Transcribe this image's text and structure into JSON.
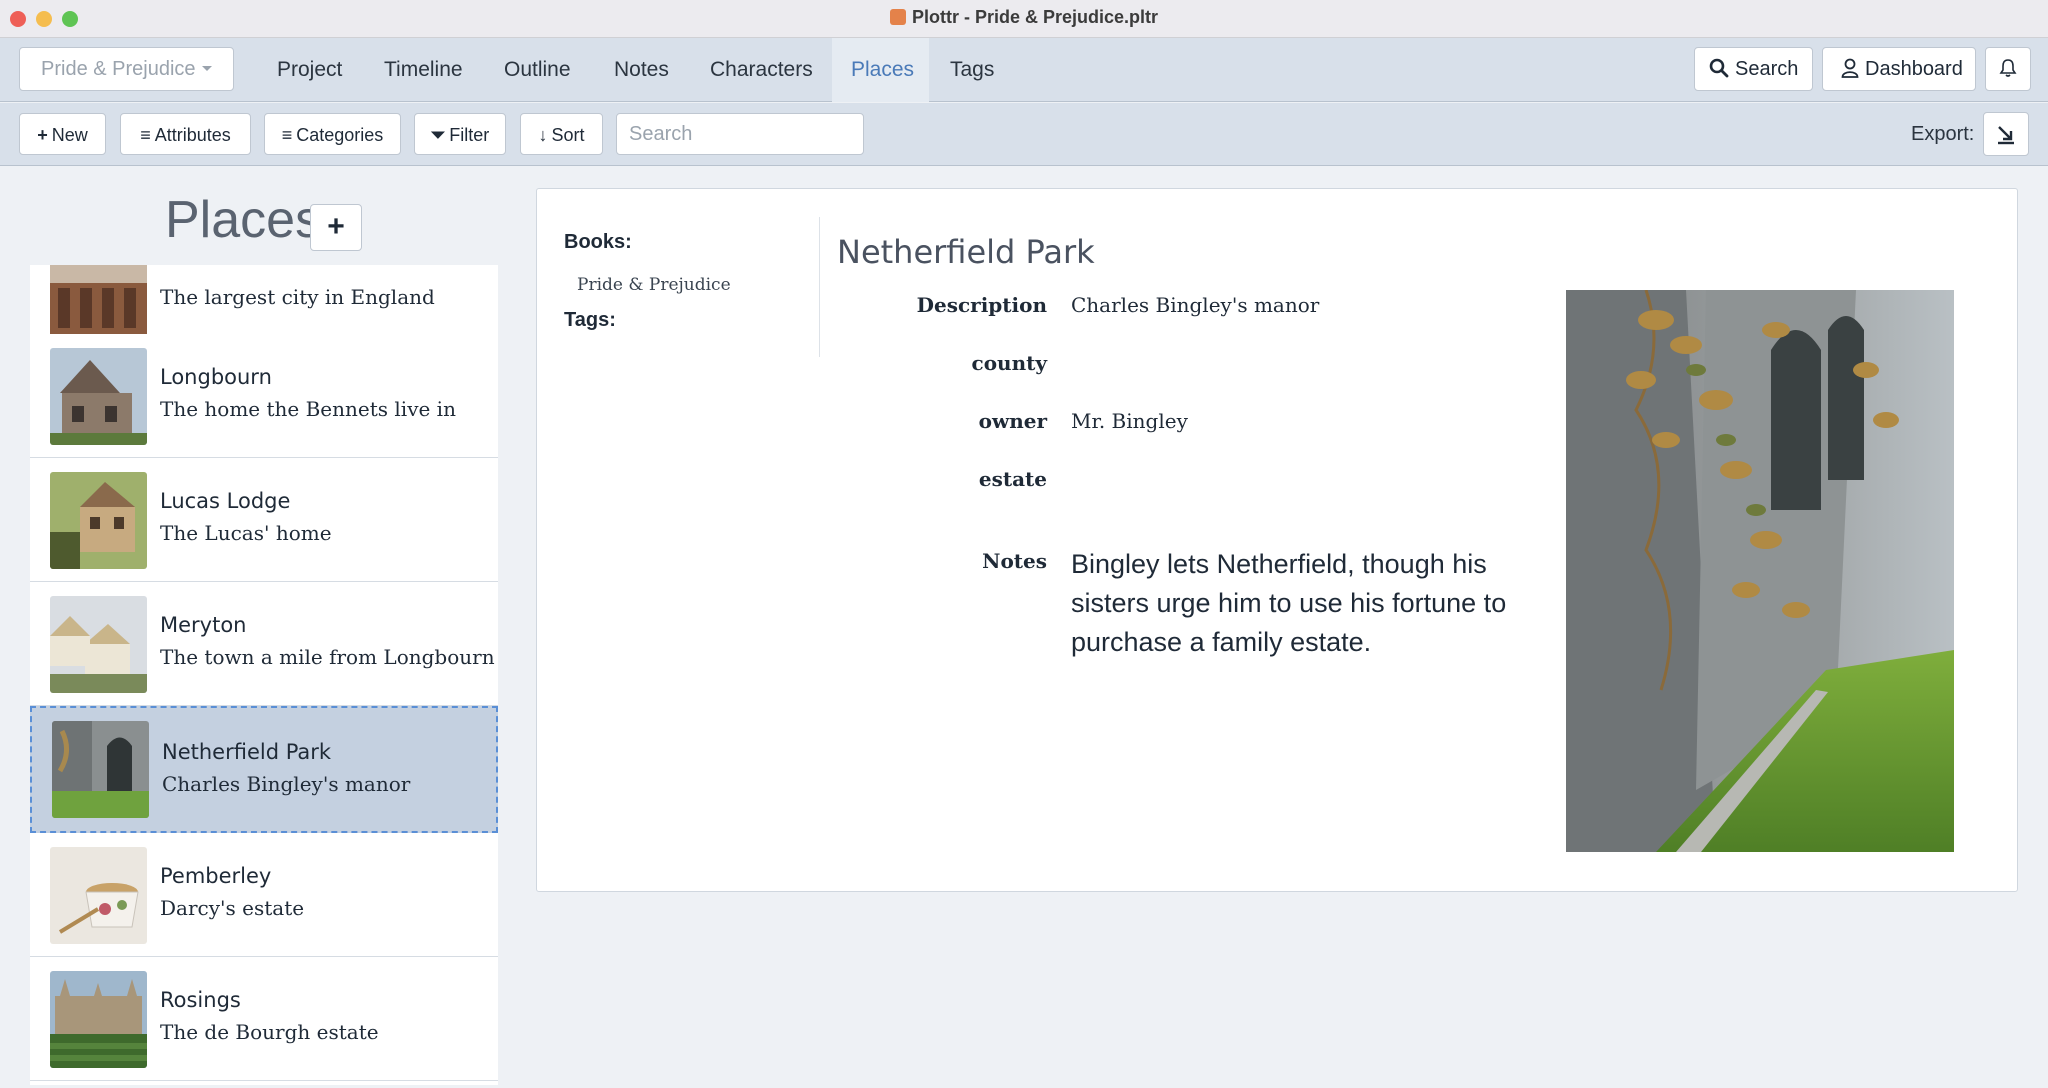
{
  "window": {
    "title": "Plottr - Pride & Prejudice.pltr"
  },
  "nav": {
    "book_selector": "Pride & Prejudice",
    "tabs": [
      "Project",
      "Timeline",
      "Outline",
      "Notes",
      "Characters",
      "Places",
      "Tags"
    ],
    "active_tab": "Places",
    "search_label": "Search",
    "dashboard_label": "Dashboard"
  },
  "toolbar": {
    "new_label": "New",
    "attributes_label": "Attributes",
    "categories_label": "Categories",
    "filter_label": "Filter",
    "sort_label": "Sort",
    "search_placeholder": "Search",
    "export_label": "Export:"
  },
  "places_panel": {
    "heading": "Places",
    "items": [
      {
        "name": "",
        "description": "The largest city in England",
        "selected": false
      },
      {
        "name": "Longbourn",
        "description": "The home the Bennets live in",
        "selected": false
      },
      {
        "name": "Lucas Lodge",
        "description": "The Lucas' home",
        "selected": false
      },
      {
        "name": "Meryton",
        "description": "The town a mile from Longbourn",
        "selected": false
      },
      {
        "name": "Netherfield Park",
        "description": "Charles Bingley's manor",
        "selected": true
      },
      {
        "name": "Pemberley",
        "description": "Darcy's estate",
        "selected": false
      },
      {
        "name": "Rosings",
        "description": "The de Bourgh estate",
        "selected": false
      }
    ]
  },
  "detail": {
    "books_label": "Books:",
    "book": "Pride & Prejudice",
    "tags_label": "Tags:",
    "title": "Netherfield Park",
    "attributes": [
      {
        "label": "Description",
        "value": "Charles Bingley's manor"
      },
      {
        "label": "county",
        "value": ""
      },
      {
        "label": "owner",
        "value": "Mr. Bingley"
      },
      {
        "label": "estate",
        "value": ""
      }
    ],
    "notes_label": "Notes",
    "notes": "Bingley lets Netherfield, though his sisters urge him to use his fortune to purchase a family estate."
  },
  "colors": {
    "nav_bg": "#d8e0ea",
    "active_tab_text": "#4a7ab8",
    "selected_item_bg": "#c4d0e0",
    "selected_item_border": "#5a8fd6"
  }
}
